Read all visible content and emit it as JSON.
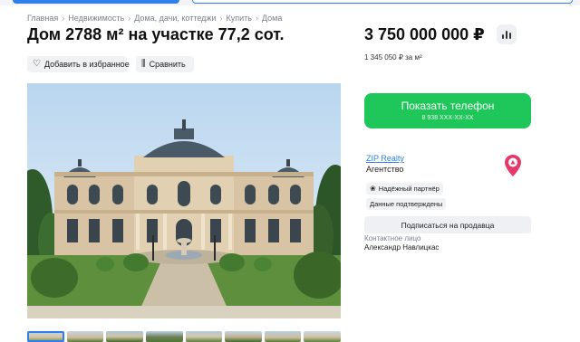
{
  "breadcrumb": {
    "items": [
      "Главная",
      "Недвижимость",
      "Дома, дачи, коттеджи",
      "Купить",
      "Дома"
    ],
    "separator": "›"
  },
  "listing": {
    "title": "Дом 2788 м² на участке 77,2 сот.",
    "price": "3 750 000 000 ₽",
    "price_per_m2": "1 345 050 ₽ за м²",
    "price_chart_icon": "bar-chart-icon"
  },
  "actions": {
    "favorite_label": "Добавить в избранное",
    "favorite_icon": "heart-icon",
    "compare_label": "Сравнить",
    "compare_icon": "compare-icon"
  },
  "contact": {
    "phone_button_label": "Показать телефон",
    "phone_masked": "8 938 XXX-XX-XX",
    "agency_name": "ZIP Realty",
    "agency_type": "Агентство",
    "badge_partner": "Надёжный партнёр",
    "badge_verified": "Данные подтверждены",
    "subscribe_label": "Подписаться на продавца",
    "contact_person_label": "Контактное лицо",
    "contact_person_name": "Александр Навлицкас"
  },
  "gallery": {
    "thumbnail_count": 8,
    "active_index": 0
  },
  "colors": {
    "accent_blue": "#2f80ed",
    "phone_green": "#1fc65a",
    "logo_red": "#e5386b"
  }
}
